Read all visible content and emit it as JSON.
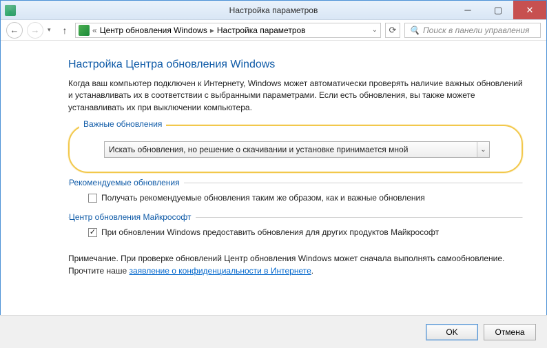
{
  "window": {
    "title": "Настройка параметров"
  },
  "nav": {
    "breadcrumb_prefix": "«",
    "crumb1": "Центр обновления Windows",
    "crumb2": "Настройка параметров"
  },
  "search": {
    "placeholder": "Поиск в панели управления"
  },
  "page": {
    "heading": "Настройка Центра обновления Windows",
    "intro": "Когда ваш компьютер подключен к Интернету, Windows может автоматически проверять наличие важных обновлений и устанавливать их в соответствии с выбранными параметрами. Если есть обновления, вы также можете устанавливать их при выключении компьютера."
  },
  "groups": {
    "important": {
      "legend": "Важные обновления",
      "selected": "Искать обновления, но решение о скачивании и установке принимается мной"
    },
    "recommended": {
      "legend": "Рекомендуемые обновления",
      "checkbox_label": "Получать рекомендуемые обновления таким же образом, как и важные обновления",
      "checked": false
    },
    "microsoft_update": {
      "legend": "Центр обновления Майкрософт",
      "checkbox_label": "При обновлении Windows предоставить обновления для других продуктов Майкрософт",
      "checked": true
    }
  },
  "note": {
    "prefix": "Примечание. При проверке обновлений Центр обновления Windows может сначала выполнять самообновление. Прочтите наше ",
    "link": "заявление о конфиденциальности в Интернете",
    "suffix": "."
  },
  "footer": {
    "ok": "OK",
    "cancel": "Отмена"
  }
}
